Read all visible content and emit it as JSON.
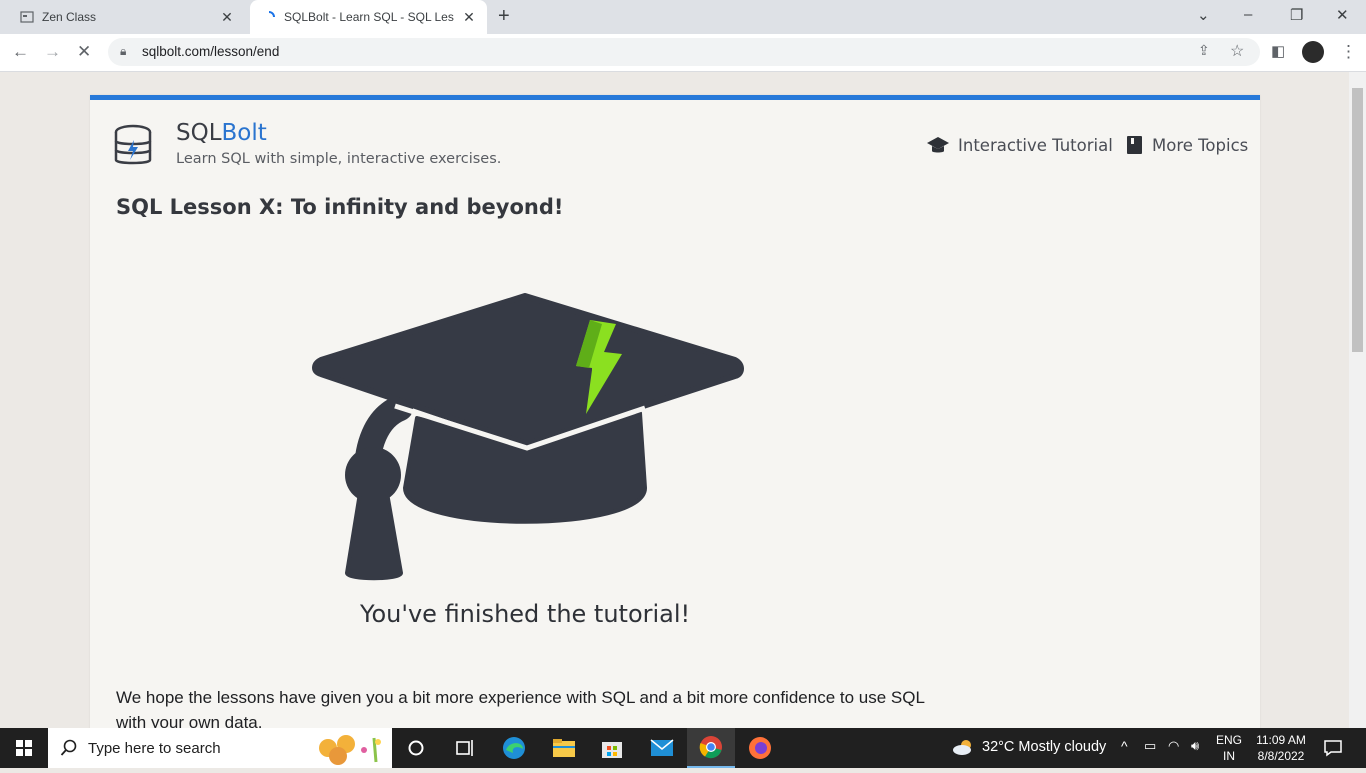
{
  "browser": {
    "tabs": [
      {
        "title": "Zen Class",
        "active": false
      },
      {
        "title": "SQLBolt - Learn SQL - SQL Lesso",
        "active": true
      }
    ],
    "url": "sqlbolt.com/lesson/end"
  },
  "site": {
    "brand_part1": "SQL",
    "brand_part2": "Bolt",
    "tagline": "Learn SQL with simple, interactive exercises.",
    "nav": {
      "tutorial": "Interactive Tutorial",
      "topics": "More Topics"
    },
    "lesson_title": "SQL Lesson X: To infinity and beyond!",
    "finished_text": "You've finished the tutorial!",
    "body_text": "We hope the lessons have given you a bit more experience with SQL and a bit more confidence to use SQL with your own data."
  },
  "taskbar": {
    "search_placeholder": "Type here to search",
    "weather": "32°C  Mostly cloudy",
    "lang_line1": "ENG",
    "lang_line2": "IN",
    "time": "11:09 AM",
    "date": "8/8/2022"
  },
  "colors": {
    "accent_blue": "#2779d9",
    "cap_dark": "#363a45",
    "bolt_green": "#8be020"
  }
}
